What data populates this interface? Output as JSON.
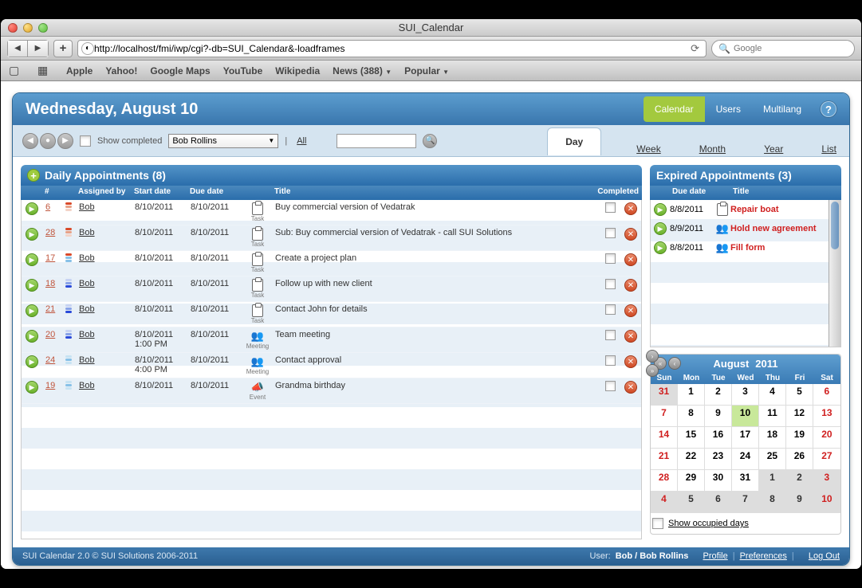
{
  "window": {
    "title": "SUI_Calendar"
  },
  "browser": {
    "url": "http://localhost/fmi/iwp/cgi?-db=SUI_Calendar&-loadframes",
    "search_placeholder": "Google",
    "bookmarks": [
      "Apple",
      "Yahoo!",
      "Google Maps",
      "YouTube",
      "Wikipedia",
      "News (388)",
      "Popular"
    ]
  },
  "header": {
    "date": "Wednesday, August 10",
    "tabs": [
      {
        "label": "Calendar",
        "active": true
      },
      {
        "label": "Users",
        "active": false
      },
      {
        "label": "Multilang",
        "active": false
      }
    ]
  },
  "subbar": {
    "show_completed_label": "Show completed",
    "user_select": "Bob Rollins",
    "all_label": "All",
    "view_tabs": [
      {
        "label": "Day",
        "active": true
      },
      {
        "label": "Week",
        "active": false
      },
      {
        "label": "Month",
        "active": false
      },
      {
        "label": "Year",
        "active": false
      },
      {
        "label": "List",
        "active": false
      }
    ]
  },
  "daily": {
    "title": "Daily Appointments (8)",
    "columns": {
      "num": "#",
      "assigned": "Assigned by",
      "start": "Start date",
      "due": "Due date",
      "title": "Title",
      "completed": "Completed"
    },
    "rows": [
      {
        "num": "6",
        "pri": "red",
        "assigned": "Bob",
        "start": "8/10/2011",
        "startTime": "",
        "due": "8/10/2011",
        "type": "Task",
        "title": "Buy commercial version of Vedatrak"
      },
      {
        "num": "28",
        "pri": "red",
        "assigned": "Bob",
        "start": "8/10/2011",
        "startTime": "",
        "due": "8/10/2011",
        "type": "Task",
        "title": "Sub: Buy commercial version of Vedatrak - call SUI Solutions"
      },
      {
        "num": "17",
        "pri": "mix",
        "assigned": "Bob",
        "start": "8/10/2011",
        "startTime": "",
        "due": "8/10/2011",
        "type": "Task",
        "title": "Create a project plan"
      },
      {
        "num": "18",
        "pri": "blue",
        "assigned": "Bob",
        "start": "8/10/2011",
        "startTime": "",
        "due": "8/10/2011",
        "type": "Task",
        "title": "Follow up with new client"
      },
      {
        "num": "21",
        "pri": "blue",
        "assigned": "Bob",
        "start": "8/10/2011",
        "startTime": "",
        "due": "8/10/2011",
        "type": "Task",
        "title": "Contact John for details"
      },
      {
        "num": "20",
        "pri": "blue",
        "assigned": "Bob",
        "start": "8/10/2011",
        "startTime": "1:00 PM",
        "due": "8/10/2011",
        "type": "Meeting",
        "title": "Team meeting"
      },
      {
        "num": "24",
        "pri": "lblue",
        "assigned": "Bob",
        "start": "8/10/2011",
        "startTime": "4:00 PM",
        "due": "8/10/2011",
        "type": "Meeting",
        "title": "Contact approval"
      },
      {
        "num": "19",
        "pri": "lblue",
        "assigned": "Bob",
        "start": "8/10/2011",
        "startTime": "",
        "due": "8/10/2011",
        "type": "Event",
        "title": "Grandma birthday"
      }
    ]
  },
  "expired": {
    "title": "Expired Appointments (3)",
    "columns": {
      "due": "Due date",
      "title": "Title"
    },
    "rows": [
      {
        "due": "8/8/2011",
        "type": "Task",
        "title": "Repair boat"
      },
      {
        "due": "8/9/2011",
        "type": "Meeting",
        "title": "Hold new agreement"
      },
      {
        "due": "8/8/2011",
        "type": "Meeting",
        "title": "Fill form"
      }
    ]
  },
  "calendar": {
    "month": "August",
    "year": "2011",
    "dow": [
      "Sun",
      "Mon",
      "Tue",
      "Wed",
      "Thu",
      "Fri",
      "Sat"
    ],
    "cells": [
      {
        "d": "31",
        "oth": true,
        "we": "sun"
      },
      {
        "d": "1"
      },
      {
        "d": "2"
      },
      {
        "d": "3"
      },
      {
        "d": "4"
      },
      {
        "d": "5"
      },
      {
        "d": "6",
        "we": "sat"
      },
      {
        "d": "7",
        "we": "sun"
      },
      {
        "d": "8"
      },
      {
        "d": "9"
      },
      {
        "d": "10",
        "today": true
      },
      {
        "d": "11"
      },
      {
        "d": "12"
      },
      {
        "d": "13",
        "we": "sat"
      },
      {
        "d": "14",
        "we": "sun"
      },
      {
        "d": "15"
      },
      {
        "d": "16"
      },
      {
        "d": "17"
      },
      {
        "d": "18"
      },
      {
        "d": "19"
      },
      {
        "d": "20",
        "we": "sat"
      },
      {
        "d": "21",
        "we": "sun"
      },
      {
        "d": "22"
      },
      {
        "d": "23"
      },
      {
        "d": "24"
      },
      {
        "d": "25"
      },
      {
        "d": "26"
      },
      {
        "d": "27",
        "we": "sat"
      },
      {
        "d": "28",
        "we": "sun"
      },
      {
        "d": "29"
      },
      {
        "d": "30"
      },
      {
        "d": "31"
      },
      {
        "d": "1",
        "oth": true
      },
      {
        "d": "2",
        "oth": true
      },
      {
        "d": "3",
        "oth": true,
        "we": "sat"
      },
      {
        "d": "4",
        "oth": true,
        "we": "sun"
      },
      {
        "d": "5",
        "oth": true
      },
      {
        "d": "6",
        "oth": true
      },
      {
        "d": "7",
        "oth": true
      },
      {
        "d": "8",
        "oth": true
      },
      {
        "d": "9",
        "oth": true
      },
      {
        "d": "10",
        "oth": true,
        "we": "sat"
      }
    ],
    "show_occupied_label": "Show occupied days"
  },
  "footer": {
    "copyright": "SUI Calendar 2.0 © SUI Solutions 2006-2011",
    "user_label": "User:",
    "user": "Bob / Bob Rollins",
    "links": [
      "Profile",
      "Preferences",
      "Log Out"
    ]
  }
}
